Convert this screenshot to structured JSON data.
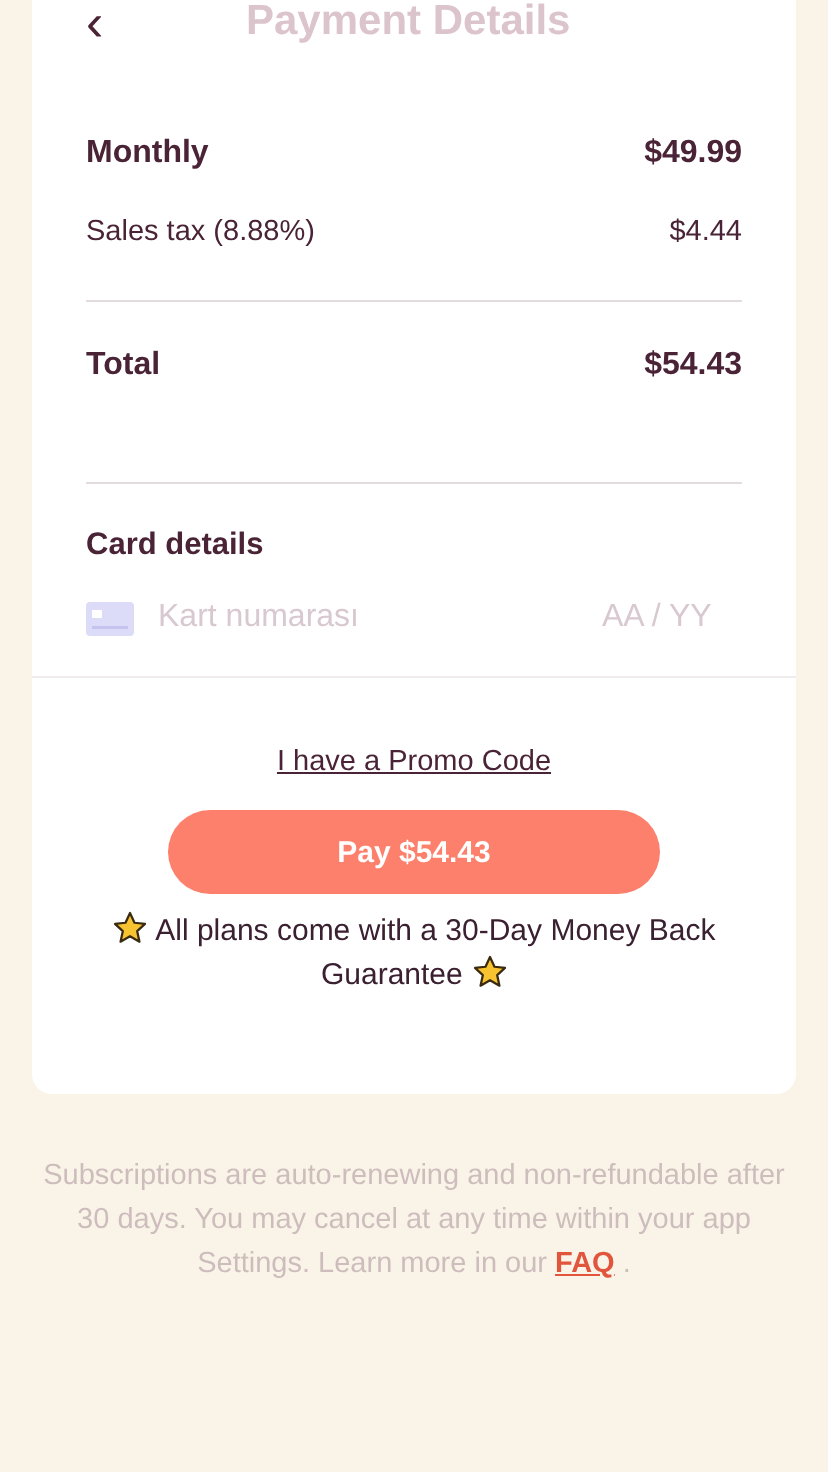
{
  "header": {
    "back_icon": "‹",
    "title": "Payment Details"
  },
  "summary": [
    {
      "label": "Monthly",
      "amount": "$49.99",
      "kind": "strong"
    },
    {
      "label": "Sales tax (8.88%)",
      "amount": "$4.44",
      "kind": "plain"
    },
    {
      "label": "Total",
      "amount": "$54.43",
      "kind": "total"
    }
  ],
  "card": {
    "heading": "Card details",
    "number": {
      "placeholder": "Kart numarası"
    },
    "expiry": {
      "placeholder": "AA / YY"
    }
  },
  "promo_link": "I have a Promo Code",
  "pay_button": "Pay $54.43",
  "guarantee": "All plans come with a 30-Day Money Back Guarantee",
  "footer": {
    "text": "Subscriptions are auto-renewing and non-refundable after 30 days. You may cancel at any time within your app Settings. Learn more in our",
    "link": "FAQ",
    "after": "."
  }
}
